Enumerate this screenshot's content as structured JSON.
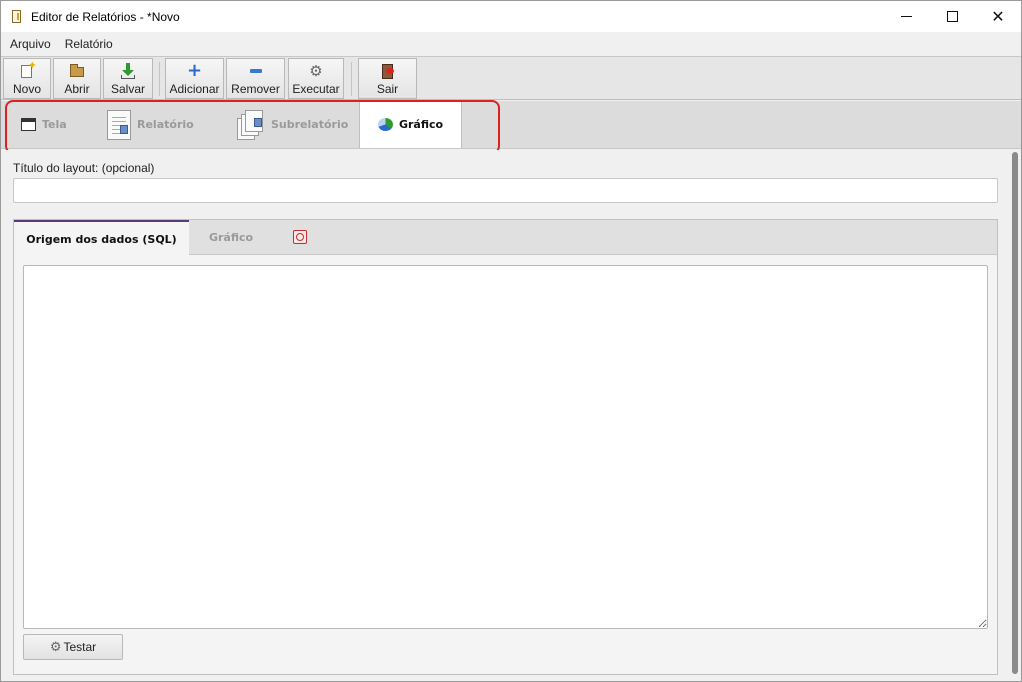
{
  "window": {
    "title": "Editor de Relatórios - *Novo"
  },
  "menu": {
    "items": [
      "Arquivo",
      "Relatório"
    ]
  },
  "toolbar": {
    "new_label": "Novo",
    "open_label": "Abrir",
    "save_label": "Salvar",
    "add_label": "Adicionar",
    "remove_label": "Remover",
    "run_label": "Executar",
    "exit_label": "Sair"
  },
  "editor_tabs": {
    "items": [
      {
        "label": "Tela",
        "icon": "window-icon"
      },
      {
        "label": "Relatório",
        "icon": "report-icon"
      },
      {
        "label": "Subrelatório",
        "icon": "subreport-icon"
      },
      {
        "label": "Gráfico",
        "icon": "pie-chart-icon",
        "active": true
      }
    ],
    "highlight_color": "#e02020"
  },
  "layout": {
    "title_label": "Título do layout: (opcional)",
    "title_value": ""
  },
  "inner_tabs": {
    "items": [
      {
        "label": "Origem dos dados (SQL)",
        "active": true
      },
      {
        "label": "Gráfico"
      }
    ],
    "accent_color": "#5a3a7a"
  },
  "sql": {
    "value": ""
  },
  "test_button": {
    "label": "Testar"
  }
}
